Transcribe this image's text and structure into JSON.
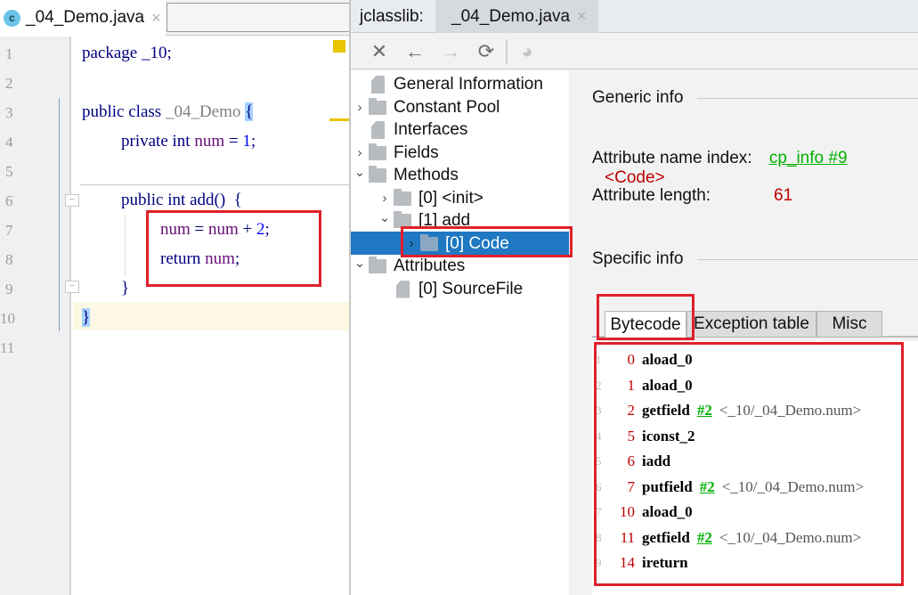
{
  "editor": {
    "tab": {
      "badge": "c",
      "title": "_04_Demo.java",
      "close": "×"
    },
    "line_numbers": [
      "1",
      "2",
      "3",
      "4",
      "5",
      "6",
      "7",
      "8",
      "9",
      "10",
      "11"
    ],
    "lines": {
      "l1": {
        "kw": "package",
        "rest": " _10;"
      },
      "l3": {
        "kw": "public class",
        "name": " _04_Demo ",
        "brace": "{"
      },
      "l4": {
        "kw": "private int",
        "field": " num",
        "eq": " = ",
        "num": "1",
        "end": ";"
      },
      "l6": {
        "kw": "public int",
        "rest": " add()  {"
      },
      "l7": {
        "field1": "num",
        "eq": " = ",
        "field2": "num",
        "plus": " + ",
        "num": "2",
        "end": ";"
      },
      "l8": {
        "kw": "return",
        "field": " num",
        "end": ";"
      },
      "l9": {
        "text": "}"
      },
      "l10": {
        "text": "}"
      }
    }
  },
  "jclasslib": {
    "label": "jclasslib:",
    "tab": {
      "title": "_04_Demo.java",
      "close": "×"
    },
    "toolbar": {
      "close": "✕",
      "back": "←",
      "forward": "→",
      "refresh": "⟳",
      "browser": "◕"
    },
    "tree": [
      {
        "label": "General Information",
        "arrow": "",
        "icon": "doc"
      },
      {
        "label": "Constant Pool",
        "arrow": "›",
        "icon": "folder"
      },
      {
        "label": "Interfaces",
        "arrow": "",
        "icon": "doc"
      },
      {
        "label": "Fields",
        "arrow": "›",
        "icon": "folder"
      },
      {
        "label": "Methods",
        "arrow": "⌄",
        "icon": "folder"
      },
      {
        "label": "[0] <init>",
        "arrow": "›",
        "icon": "folder"
      },
      {
        "label": "[1] add",
        "arrow": "⌄",
        "icon": "folder"
      },
      {
        "label": "[0] Code",
        "arrow": "›",
        "icon": "folder",
        "selected": true
      },
      {
        "label": "Attributes",
        "arrow": "⌄",
        "icon": "folder"
      },
      {
        "label": "[0] SourceFile",
        "arrow": "",
        "icon": "doc"
      }
    ],
    "detail": {
      "generic_title": "Generic info",
      "name_index_label": "Attribute name index:",
      "name_index_link": "cp_info #9",
      "name_index_value": "<Code>",
      "length_label": "Attribute length:",
      "length_value": "61",
      "specific_title": "Specific info",
      "tabs": [
        "Bytecode",
        "Exception table",
        "Misc"
      ],
      "active_tab": "Bytecode",
      "bytecode": [
        {
          "line": "1",
          "offset": "0",
          "op": "aload_0",
          "ref": "",
          "comment": ""
        },
        {
          "line": "2",
          "offset": "1",
          "op": "aload_0",
          "ref": "",
          "comment": ""
        },
        {
          "line": "3",
          "offset": "2",
          "op": "getfield",
          "ref": "#2",
          "comment": "<_10/_04_Demo.num>"
        },
        {
          "line": "4",
          "offset": "5",
          "op": "iconst_2",
          "ref": "",
          "comment": ""
        },
        {
          "line": "5",
          "offset": "6",
          "op": "iadd",
          "ref": "",
          "comment": ""
        },
        {
          "line": "6",
          "offset": "7",
          "op": "putfield",
          "ref": "#2",
          "comment": "<_10/_04_Demo.num>"
        },
        {
          "line": "7",
          "offset": "10",
          "op": "aload_0",
          "ref": "",
          "comment": ""
        },
        {
          "line": "8",
          "offset": "11",
          "op": "getfield",
          "ref": "#2",
          "comment": "<_10/_04_Demo.num>"
        },
        {
          "line": "9",
          "offset": "14",
          "op": "ireturn",
          "ref": "",
          "comment": ""
        }
      ]
    }
  },
  "colors": {
    "highlight_box": "#e0202a",
    "selection": "#1f78c1",
    "link": "#00b000",
    "value": "#c00000"
  }
}
